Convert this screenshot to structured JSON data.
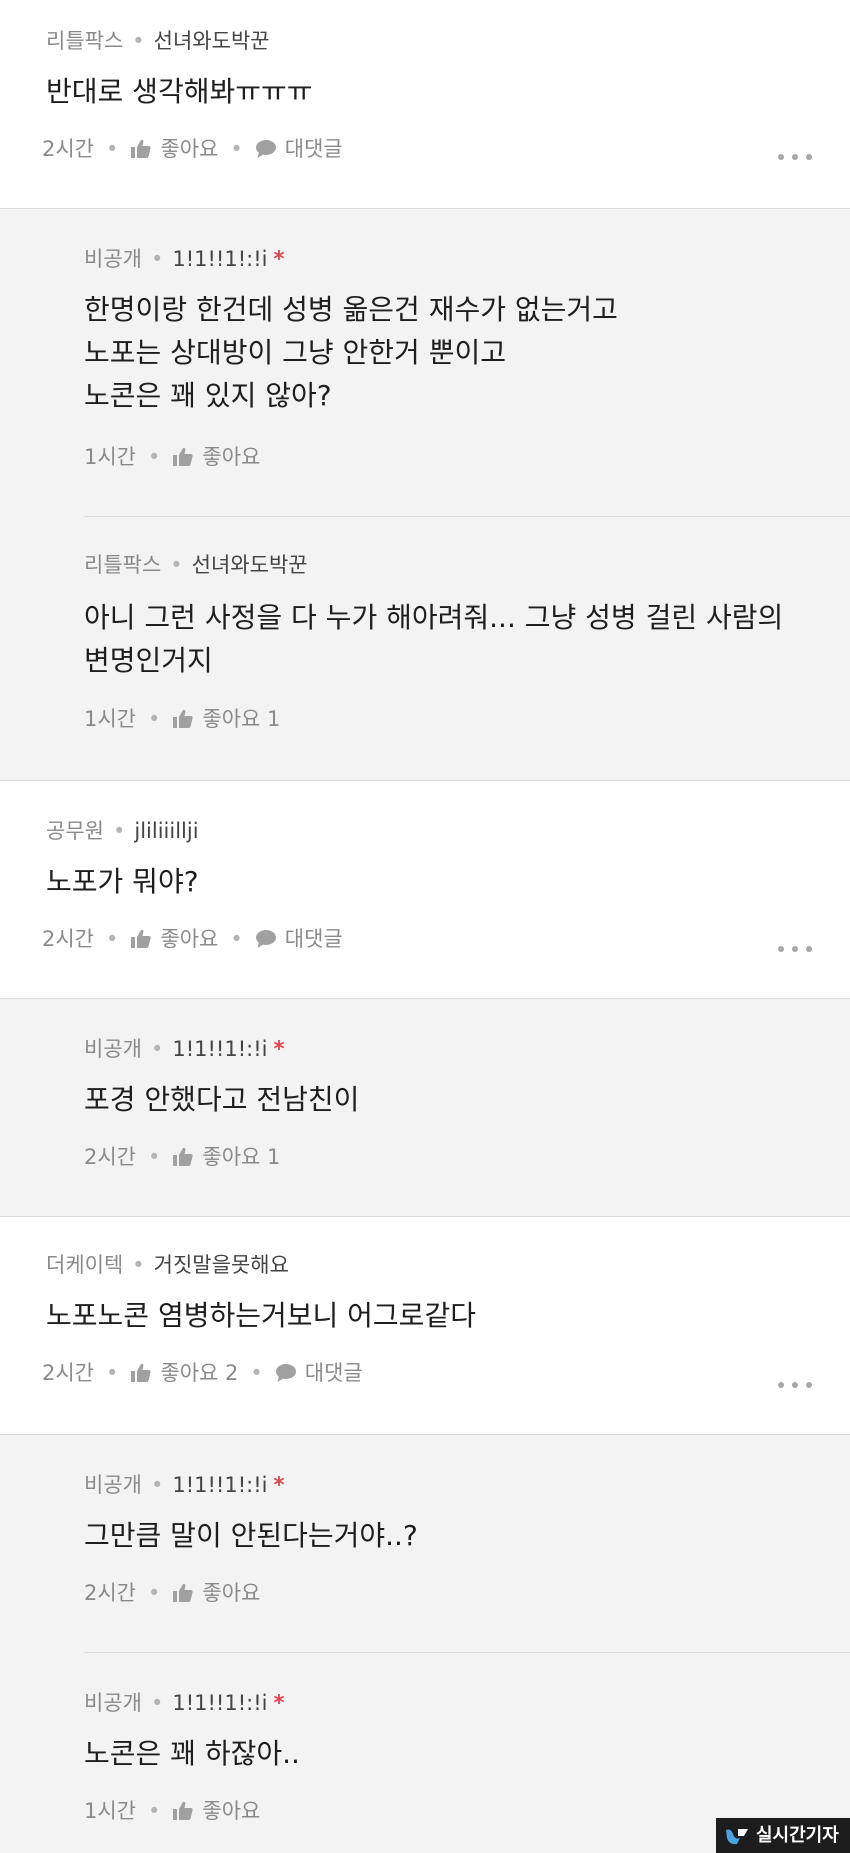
{
  "comments": [
    {
      "level": "리틀팍스",
      "nick": "선녀와도박꾼",
      "lines": [
        "반대로 생각해봐ㅠㅠㅠ"
      ],
      "time": "2시간",
      "like": "좋아요",
      "reply": "대댓글"
    },
    {
      "level": "비공개",
      "nick": "1!1!!1!:!i",
      "lines": [
        "한명이랑 한건데 성병 옮은건 재수가 없는거고",
        "노포는 상대방이 그냥 안한거 뿐이고",
        "노콘은 꽤 있지 않아?"
      ],
      "time": "1시간",
      "like": "좋아요"
    },
    {
      "level": "리틀팍스",
      "nick": "선녀와도박꾼",
      "lines": [
        "아니 그런 사정을 다 누가 해아려줘... 그냥 성병 걸린 사람의",
        "변명인거지"
      ],
      "time": "1시간",
      "like": "좋아요 1"
    },
    {
      "level": "공무원",
      "nick": "jliliiilljі",
      "lines": [
        "노포가 뭐야?"
      ],
      "time": "2시간",
      "like": "좋아요",
      "reply": "대댓글"
    },
    {
      "level": "비공개",
      "nick": "1!1!!1!:!i",
      "lines": [
        "포경 안했다고 전남친이"
      ],
      "time": "2시간",
      "like": "좋아요 1"
    },
    {
      "level": "더케이텍",
      "nick": "거짓말을못해요",
      "lines": [
        "노포노콘 염병하는거보니 어그로같다"
      ],
      "time": "2시간",
      "like": "좋아요 2",
      "reply": "대댓글"
    },
    {
      "level": "비공개",
      "nick": "1!1!!1!:!i",
      "lines": [
        "그만큼 말이 안된다는거야..?"
      ],
      "time": "2시간",
      "like": "좋아요"
    },
    {
      "level": "비공개",
      "nick": "1!1!!1!:!i",
      "lines": [
        "노콘은 꽤 하잖아.."
      ],
      "time": "1시간",
      "like": "좋아요"
    }
  ],
  "icons": {
    "like": "thumbs-up-icon",
    "reply": "speech-bubble-icon",
    "more": "more-dots-icon",
    "star": "asterisk-icon"
  },
  "colors": {
    "reply_bg": "#f3f3f3",
    "star": "#e0464a",
    "meta": "#8a8a8a"
  },
  "watermark": {
    "text": "실시간기자"
  }
}
